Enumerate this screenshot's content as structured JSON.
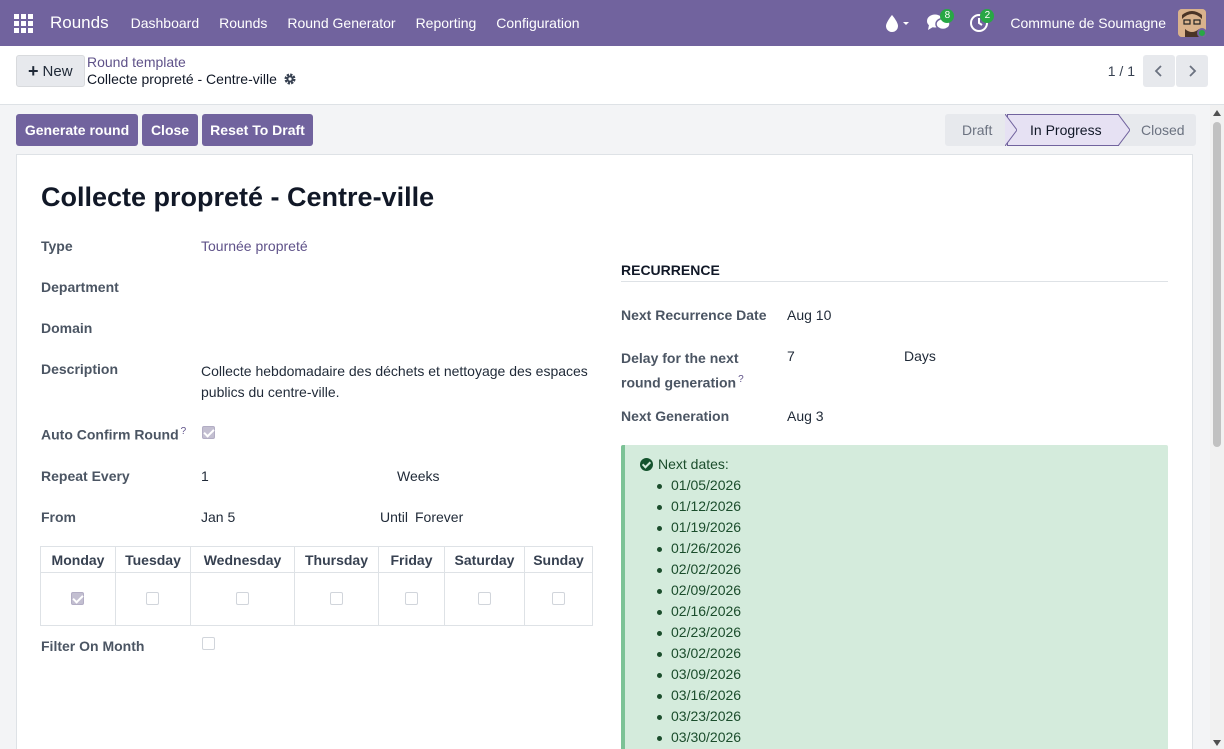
{
  "navbar": {
    "brand": "Rounds",
    "menu": [
      "Dashboard",
      "Rounds",
      "Round Generator",
      "Reporting",
      "Configuration"
    ],
    "messages_count": "8",
    "activities_count": "2",
    "company": "Commune de Soumagne"
  },
  "control": {
    "new_label": "New",
    "breadcrumb": "Round template",
    "record_name": "Collecte propreté - Centre-ville",
    "pager": "1 / 1"
  },
  "actions": {
    "generate": "Generate round",
    "close": "Close",
    "reset": "Reset To Draft"
  },
  "status": {
    "steps": [
      "Draft",
      "In Progress",
      "Closed"
    ],
    "active": "In Progress"
  },
  "form": {
    "title": "Collecte propreté - Centre-ville",
    "type_label": "Type",
    "type_value": "Tournée propreté",
    "department_label": "Department",
    "domain_label": "Domain",
    "description_label": "Description",
    "description_line1": "Collecte hebdomadaire des déchets et nettoyage des espaces",
    "description_line2": "publics du centre-ville.",
    "auto_confirm_label": "Auto Confirm Round",
    "auto_confirm_checked": true,
    "repeat_label": "Repeat Every",
    "repeat_value": "1",
    "repeat_unit": "Weeks",
    "from_label": "From",
    "from_value": "Jan 5",
    "until_label": "Until",
    "until_value": "Forever",
    "days": [
      "Monday",
      "Tuesday",
      "Wednesday",
      "Thursday",
      "Friday",
      "Saturday",
      "Sunday"
    ],
    "days_checked": [
      true,
      false,
      false,
      false,
      false,
      false,
      false
    ],
    "filter_month_label": "Filter On Month",
    "filter_month_checked": false
  },
  "recurrence": {
    "header": "RECURRENCE",
    "next_date_label": "Next Recurrence Date",
    "next_date_value": "Aug 10",
    "delay_label_line1": "Delay for the next",
    "delay_label_line2": "round generation",
    "delay_value": "7",
    "delay_unit": "Days",
    "next_gen_label": "Next Generation",
    "next_gen_value": "Aug 3",
    "next_dates_title": "Next dates:",
    "next_dates": [
      "01/05/2026",
      "01/12/2026",
      "01/19/2026",
      "01/26/2026",
      "02/02/2026",
      "02/09/2026",
      "02/16/2026",
      "02/23/2026",
      "03/02/2026",
      "03/09/2026",
      "03/16/2026",
      "03/23/2026",
      "03/30/2026"
    ]
  },
  "colors": {
    "brand": "#71639e",
    "success_bg": "#d4ebdc",
    "success_text": "#1b4d2c"
  }
}
